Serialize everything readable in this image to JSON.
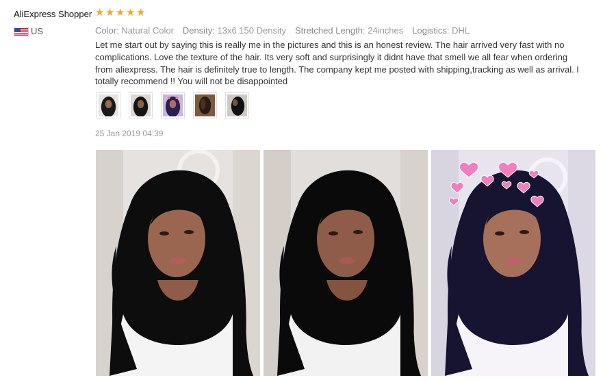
{
  "reviewer": {
    "name": "AliExpress Shopper",
    "country": "US",
    "rating": 5
  },
  "attributes": [
    {
      "label": "Color:",
      "value": "Natural Color"
    },
    {
      "label": "Density:",
      "value": "13x6 150 Density"
    },
    {
      "label": "Stretched Length:",
      "value": "24inches"
    },
    {
      "label": "Logistics:",
      "value": "DHL"
    }
  ],
  "review_text": "Let me start out by saying this is really me in the pictures and this is an honest review. The hair arrived very fast with no complications. Love the texture of the hair. Its very soft and surprisingly it didnt have that smell we all fear when ordering from aliexpress. The hair is definitely true to length. The company kept me posted with shipping,tracking as well as arrival. I totally recommend !! You will not be disappointed",
  "review_date": "25 Jan 2019 04:39",
  "colors": {
    "star": "#f5a623",
    "label": "#888888",
    "text": "#333333"
  },
  "thumbnails": [
    {
      "icon": "photo-thumbnail-1"
    },
    {
      "icon": "photo-thumbnail-2"
    },
    {
      "icon": "photo-thumbnail-3"
    },
    {
      "icon": "photo-thumbnail-4"
    },
    {
      "icon": "photo-thumbnail-5"
    }
  ],
  "photos": [
    {
      "icon": "review-photo-1"
    },
    {
      "icon": "review-photo-2"
    },
    {
      "icon": "review-photo-3-hearts"
    }
  ]
}
